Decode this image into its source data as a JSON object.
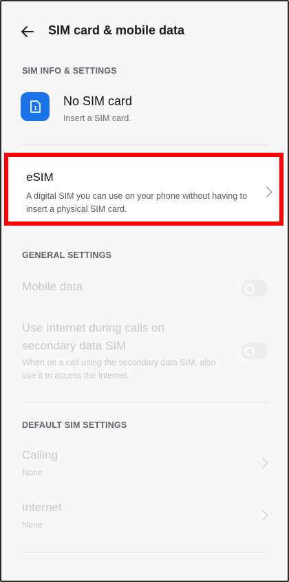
{
  "header": {
    "title": "SIM card & mobile data"
  },
  "sections": {
    "sim_info": "SIM INFO & SETTINGS",
    "general": "GENERAL SETTINGS",
    "default_sim": "DEFAULT SIM SETTINGS"
  },
  "sim": {
    "title": "No SIM card",
    "subtitle": "Insert a SIM card.",
    "icon": "sim-card-icon",
    "icon_label": "1"
  },
  "esim": {
    "title": "eSIM",
    "description": "A digital SIM you can use on your phone without having to insert a physical SIM card."
  },
  "general": {
    "mobile_data": {
      "label": "Mobile data",
      "enabled": false
    },
    "internet_calls": {
      "label": "Use Internet during calls on secondary data SIM",
      "description": "When on a call using the secondary data SIM, also use it to access the Internet.",
      "enabled": false
    }
  },
  "default_sim": {
    "calling": {
      "label": "Calling",
      "value": "None"
    },
    "internet": {
      "label": "Internet",
      "value": "None"
    }
  },
  "colors": {
    "accent": "#1a73e8",
    "highlight": "#ff0000"
  }
}
